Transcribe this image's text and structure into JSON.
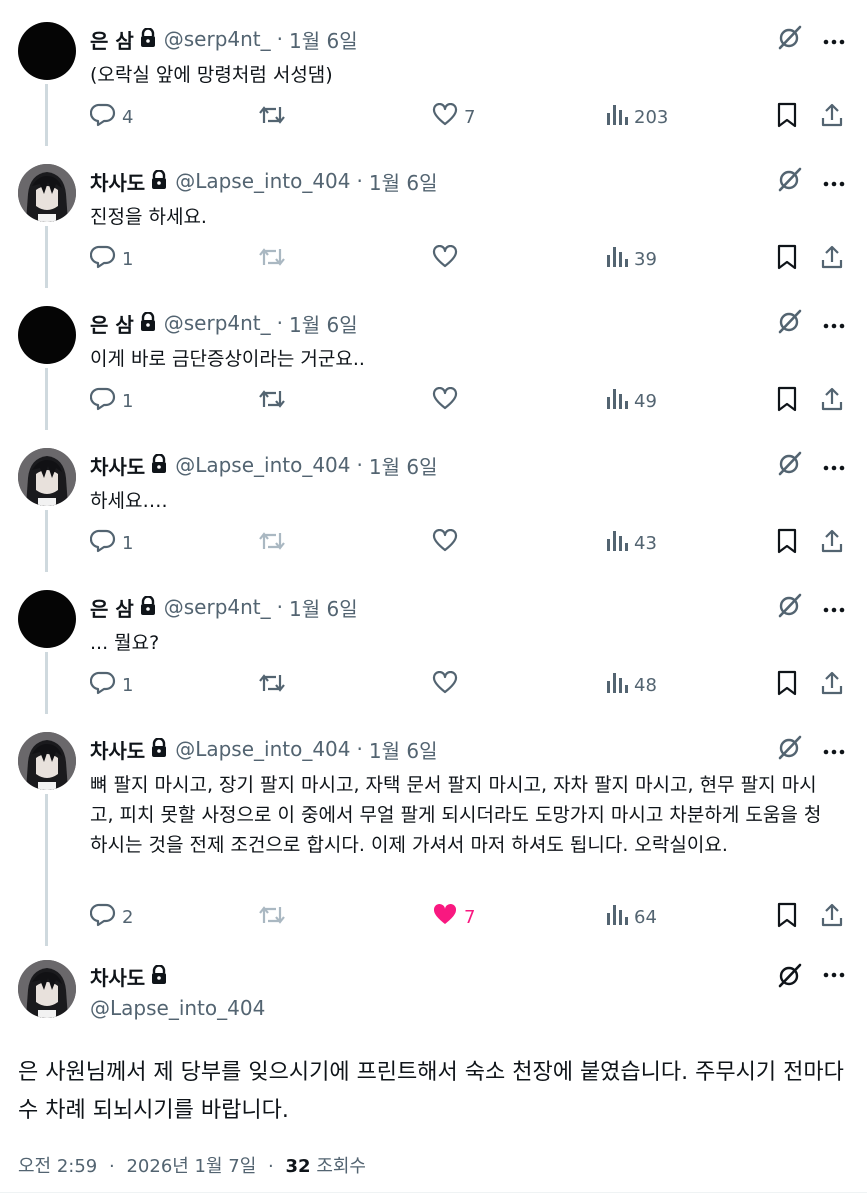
{
  "tweets": [
    {
      "name": "은 삼",
      "handle": "@serp4nt_",
      "date": "1월 6일",
      "text": "(오락실 앞에 망령처럼 서성댐)",
      "replies": "4",
      "retweets": "",
      "likes": "7",
      "views": "203",
      "avatar": "black-avatar",
      "liked": false
    },
    {
      "name": "차사도",
      "handle": "@Lapse_into_404",
      "date": "1월 6일",
      "text": "진정을 하세요.",
      "replies": "1",
      "retweets": "",
      "likes": "",
      "views": "39",
      "avatar": "anime-avatar",
      "liked": false
    },
    {
      "name": "은 삼",
      "handle": "@serp4nt_",
      "date": "1월 6일",
      "text": "이게 바로 금단증상이라는 거군요..",
      "replies": "1",
      "retweets": "",
      "likes": "",
      "views": "49",
      "avatar": "black-avatar",
      "liked": false
    },
    {
      "name": "차사도",
      "handle": "@Lapse_into_404",
      "date": "1월 6일",
      "text": "하세요….",
      "replies": "1",
      "retweets": "",
      "likes": "",
      "views": "43",
      "avatar": "anime-avatar",
      "liked": false
    },
    {
      "name": "은 삼",
      "handle": "@serp4nt_",
      "date": "1월 6일",
      "text": "... 뭘요?",
      "replies": "1",
      "retweets": "",
      "likes": "",
      "views": "48",
      "avatar": "black-avatar",
      "liked": false
    },
    {
      "name": "차사도",
      "handle": "@Lapse_into_404",
      "date": "1월 6일",
      "text": "뼈 팔지 마시고, 장기 팔지 마시고, 자택 문서 팔지 마시고, 자차 팔지 마시고, 현무 팔지 마시고, 피치 못할 사정으로 이 중에서 무얼 팔게 되시더라도 도망가지 마시고 차분하게 도움을 청하시는 것을 전제 조건으로 합시다. 이제 가셔서 마저 하셔도 됩니다. 오락실이요.",
      "replies": "2",
      "retweets": "",
      "likes": "7",
      "views": "64",
      "avatar": "anime-avatar",
      "liked": true
    }
  ],
  "main": {
    "name": "차사도",
    "handle": "@Lapse_into_404",
    "text": "은 사원님께서 제 당부를 잊으시기에 프린트해서 숙소 천장에 붙였습니다. 주무시기 전마다 수 차례 되뇌시기를 바랍니다.",
    "time": "오전 2:59",
    "date": "2026년 1월 7일",
    "views_count": "32",
    "views_label": "조회수"
  },
  "separator": "·",
  "colors": {
    "like_active": "#f91880",
    "muted": "#536471",
    "text": "#0f1419",
    "thread_line": "#cfd9de"
  },
  "icons": [
    "lock-icon",
    "grok-icon",
    "more-icon",
    "reply-icon",
    "retweet-icon",
    "like-icon",
    "views-icon",
    "bookmark-icon",
    "share-icon"
  ]
}
